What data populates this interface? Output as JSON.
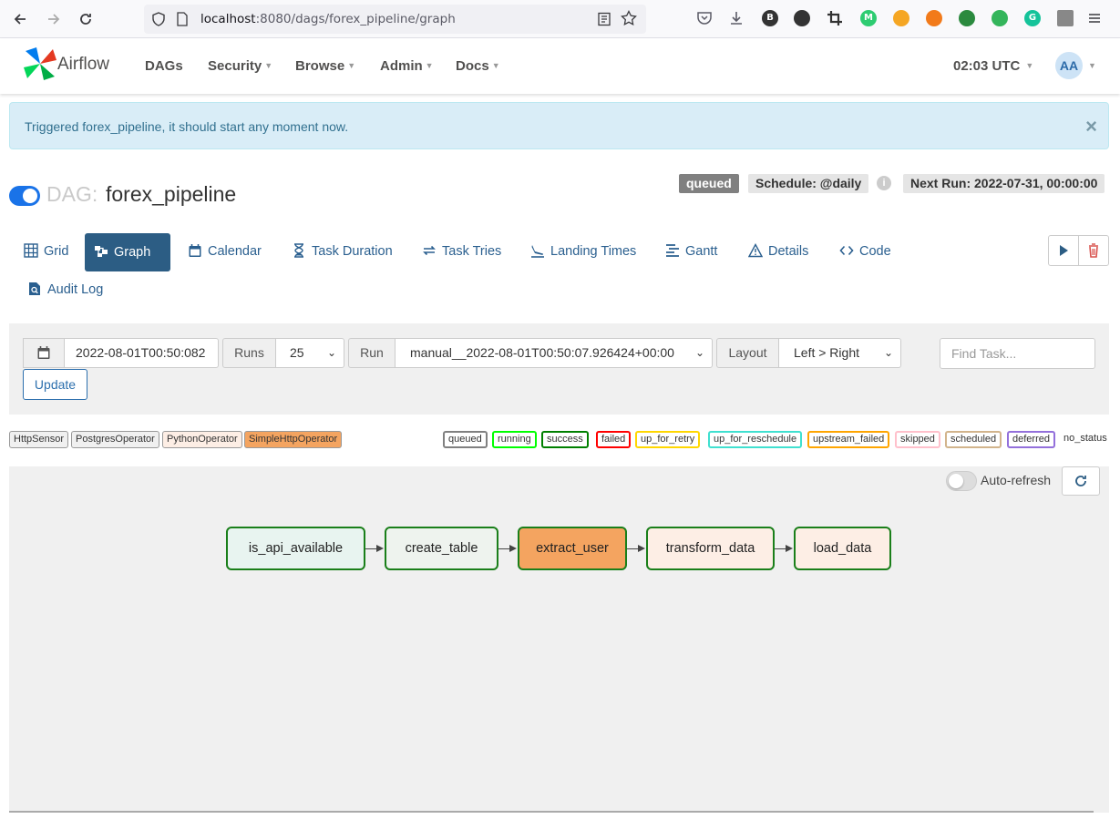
{
  "browser": {
    "url_host": "localhost",
    "url_rest": ":8080/dags/forex_pipeline/graph",
    "extension_icons": [
      {
        "name": "pocket-icon",
        "color": "#5b5b66"
      },
      {
        "name": "download-icon",
        "color": "#5b5b66"
      },
      {
        "name": "b-extension-icon",
        "color": "#333333",
        "text": "B"
      },
      {
        "name": "circles-extension-icon",
        "color": "#333333"
      },
      {
        "name": "crop-extension-icon",
        "color": "#333333"
      },
      {
        "name": "m-extension-icon",
        "color": "#2ecc71",
        "text": "M"
      },
      {
        "name": "gauge-extension-icon",
        "color": "#f5a623"
      },
      {
        "name": "a-extension-icon",
        "color": "#f27a1a"
      },
      {
        "name": "timer-extension-icon",
        "color": "#2b8a3e"
      },
      {
        "name": "shield-extension-icon",
        "color": "#34b55b"
      },
      {
        "name": "grammarly-icon",
        "color": "#15c39a",
        "text": "G"
      },
      {
        "name": "grid-extension-icon",
        "color": "#888888"
      },
      {
        "name": "menu-icon",
        "color": "#3b3b3f"
      }
    ]
  },
  "navbar": {
    "brand": "Airflow",
    "menu": [
      {
        "label": "DAGs",
        "caret": false
      },
      {
        "label": "Security",
        "caret": true
      },
      {
        "label": "Browse",
        "caret": true
      },
      {
        "label": "Admin",
        "caret": true
      },
      {
        "label": "Docs",
        "caret": true
      }
    ],
    "clock": "02:03 UTC",
    "avatar": "AA"
  },
  "alert": {
    "message": "Triggered forex_pipeline, it should start any moment now.",
    "close": "×"
  },
  "dag": {
    "label": "DAG:",
    "name": "forex_pipeline",
    "paused": false,
    "state_badge": "queued",
    "schedule": "Schedule: @daily",
    "info": "i",
    "next_run": "Next Run: 2022-07-31, 00:00:00"
  },
  "tabs": [
    {
      "label": "Grid",
      "icon": "grid-icon",
      "active": false
    },
    {
      "label": "Graph",
      "icon": "graph-icon",
      "active": true
    },
    {
      "label": "Calendar",
      "icon": "calendar-icon",
      "active": false
    },
    {
      "label": "Task Duration",
      "icon": "hourglass-icon",
      "active": false
    },
    {
      "label": "Task Tries",
      "icon": "repeat-icon",
      "active": false
    },
    {
      "label": "Landing Times",
      "icon": "plane-landing-icon",
      "active": false
    },
    {
      "label": "Gantt",
      "icon": "gantt-icon",
      "active": false
    },
    {
      "label": "Details",
      "icon": "warning-triangle-icon",
      "active": false
    },
    {
      "label": "Code",
      "icon": "code-icon",
      "active": false
    },
    {
      "label": "Audit Log",
      "icon": "file-search-icon",
      "active": false
    }
  ],
  "filters": {
    "base_date": "2022-08-01T00:50:082",
    "runs_label": "Runs",
    "runs_value": "25",
    "run_label": "Run",
    "run_value": "manual__2022-08-01T00:50:07.926424+00:00",
    "layout_label": "Layout",
    "layout_value": "Left > Right",
    "update_label": "Update",
    "find_placeholder": "Find Task..."
  },
  "operator_legend": [
    {
      "label": "HttpSensor",
      "bg": "#f0f0f0"
    },
    {
      "label": "PostgresOperator",
      "bg": "#f0f0f0"
    },
    {
      "label": "PythonOperator",
      "bg": "#fdeee5"
    },
    {
      "label": "SimpleHttpOperator",
      "bg": "#f4a460"
    }
  ],
  "state_legend": [
    {
      "label": "queued",
      "color": "#808080"
    },
    {
      "label": "running",
      "color": "#00ff00"
    },
    {
      "label": "success",
      "color": "#008000"
    },
    {
      "label": "failed",
      "color": "#ff0000"
    },
    {
      "label": "up_for_retry",
      "color": "#ffd700"
    },
    {
      "label": "up_for_reschedule",
      "color": "#40e0d0"
    },
    {
      "label": "upstream_failed",
      "color": "#ffa500"
    },
    {
      "label": "skipped",
      "color": "#ffc0cb"
    },
    {
      "label": "scheduled",
      "color": "#d2b48c"
    },
    {
      "label": "deferred",
      "color": "#9370db"
    },
    {
      "label": "no_status",
      "color": "none"
    }
  ],
  "graph": {
    "auto_refresh_label": "Auto-refresh",
    "auto_refresh_on": false,
    "tasks": [
      {
        "id": "is_api_available",
        "bg": "#e8f4f0"
      },
      {
        "id": "create_table",
        "bg": "#eef3ee"
      },
      {
        "id": "extract_user",
        "bg": "#f4a460"
      },
      {
        "id": "transform_data",
        "bg": "#fdeee5"
      },
      {
        "id": "load_data",
        "bg": "#fdeee5"
      }
    ]
  }
}
